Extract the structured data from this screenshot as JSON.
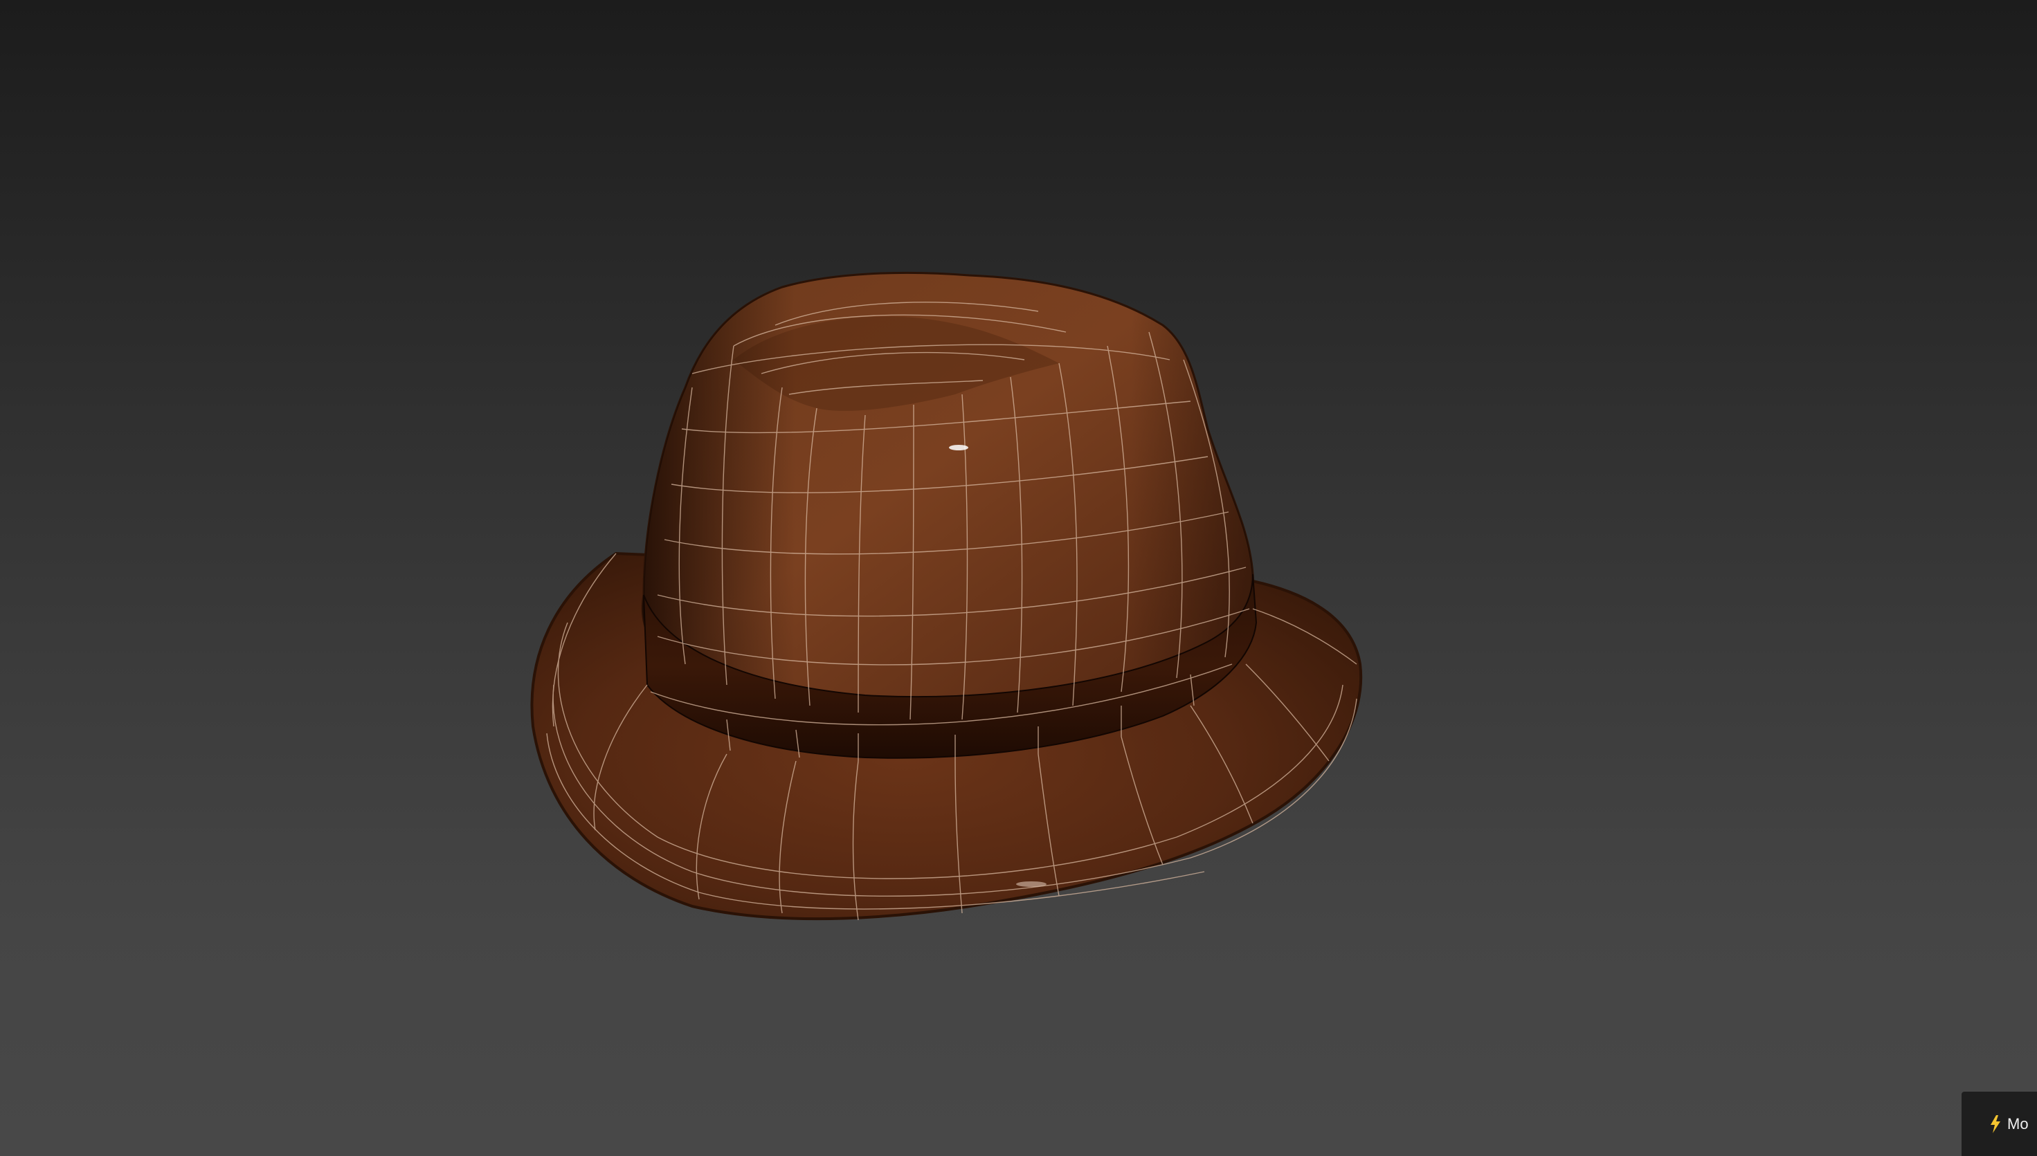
{
  "viewport": {
    "object_name": "hat-model",
    "material_color": "#5a2e14",
    "wire_color": "#d8b8a0",
    "background_top": "#1c1c1c",
    "background_bottom": "#484848"
  },
  "badge": {
    "icon": "lightning-bolt-icon",
    "label": "Mo"
  }
}
